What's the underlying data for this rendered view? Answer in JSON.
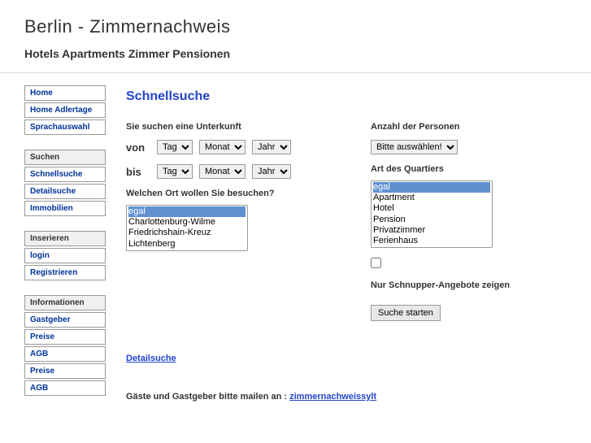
{
  "header": {
    "title": "Berlin - Zimmernachweis",
    "subtitle": "Hotels Apartments Zimmer Pensionen"
  },
  "sidebar": {
    "group1": {
      "items": [
        "Home",
        "Home Adlertage",
        "Sprachauswahl"
      ]
    },
    "group2": {
      "header": "Suchen",
      "items": [
        "Schnellsuche",
        "Detailsuche",
        "Immobilien"
      ]
    },
    "group3": {
      "header": "Inserieren",
      "items": [
        "login",
        "Registrieren"
      ]
    },
    "group4": {
      "header": "Informationen",
      "items": [
        "Gastgeber",
        "Preise",
        "AGB",
        "Preise",
        "AGB"
      ]
    }
  },
  "main": {
    "title": "Schnellsuche",
    "search_label": "Sie suchen eine Unterkunft",
    "from_label": "von",
    "to_label": "bis",
    "day_placeholder": "Tag",
    "month_placeholder": "Monat",
    "year_placeholder": "Jahr",
    "location_label": "Welchen Ort wollen Sie besuchen?",
    "location_options": [
      "egal",
      "Charlottenburg-Wilme",
      "Friedrichshain-Kreuz",
      "Lichtenberg"
    ],
    "persons_label": "Anzahl der Personen",
    "persons_placeholder": "Bitte auswählen!",
    "type_label": "Art des Quartiers",
    "type_options": [
      "egal",
      "Apartment",
      "Hotel",
      "Pension",
      "Privatzimmer",
      "Ferienhaus"
    ],
    "schnupper_label": "Nur Schnupper-Angebote zeigen",
    "submit_label": "Suche starten",
    "detail_link": "Detailsuche",
    "footer_text": "Gäste und Gastgeber bitte mailen an : ",
    "footer_link": "zimmernachweissylt"
  }
}
